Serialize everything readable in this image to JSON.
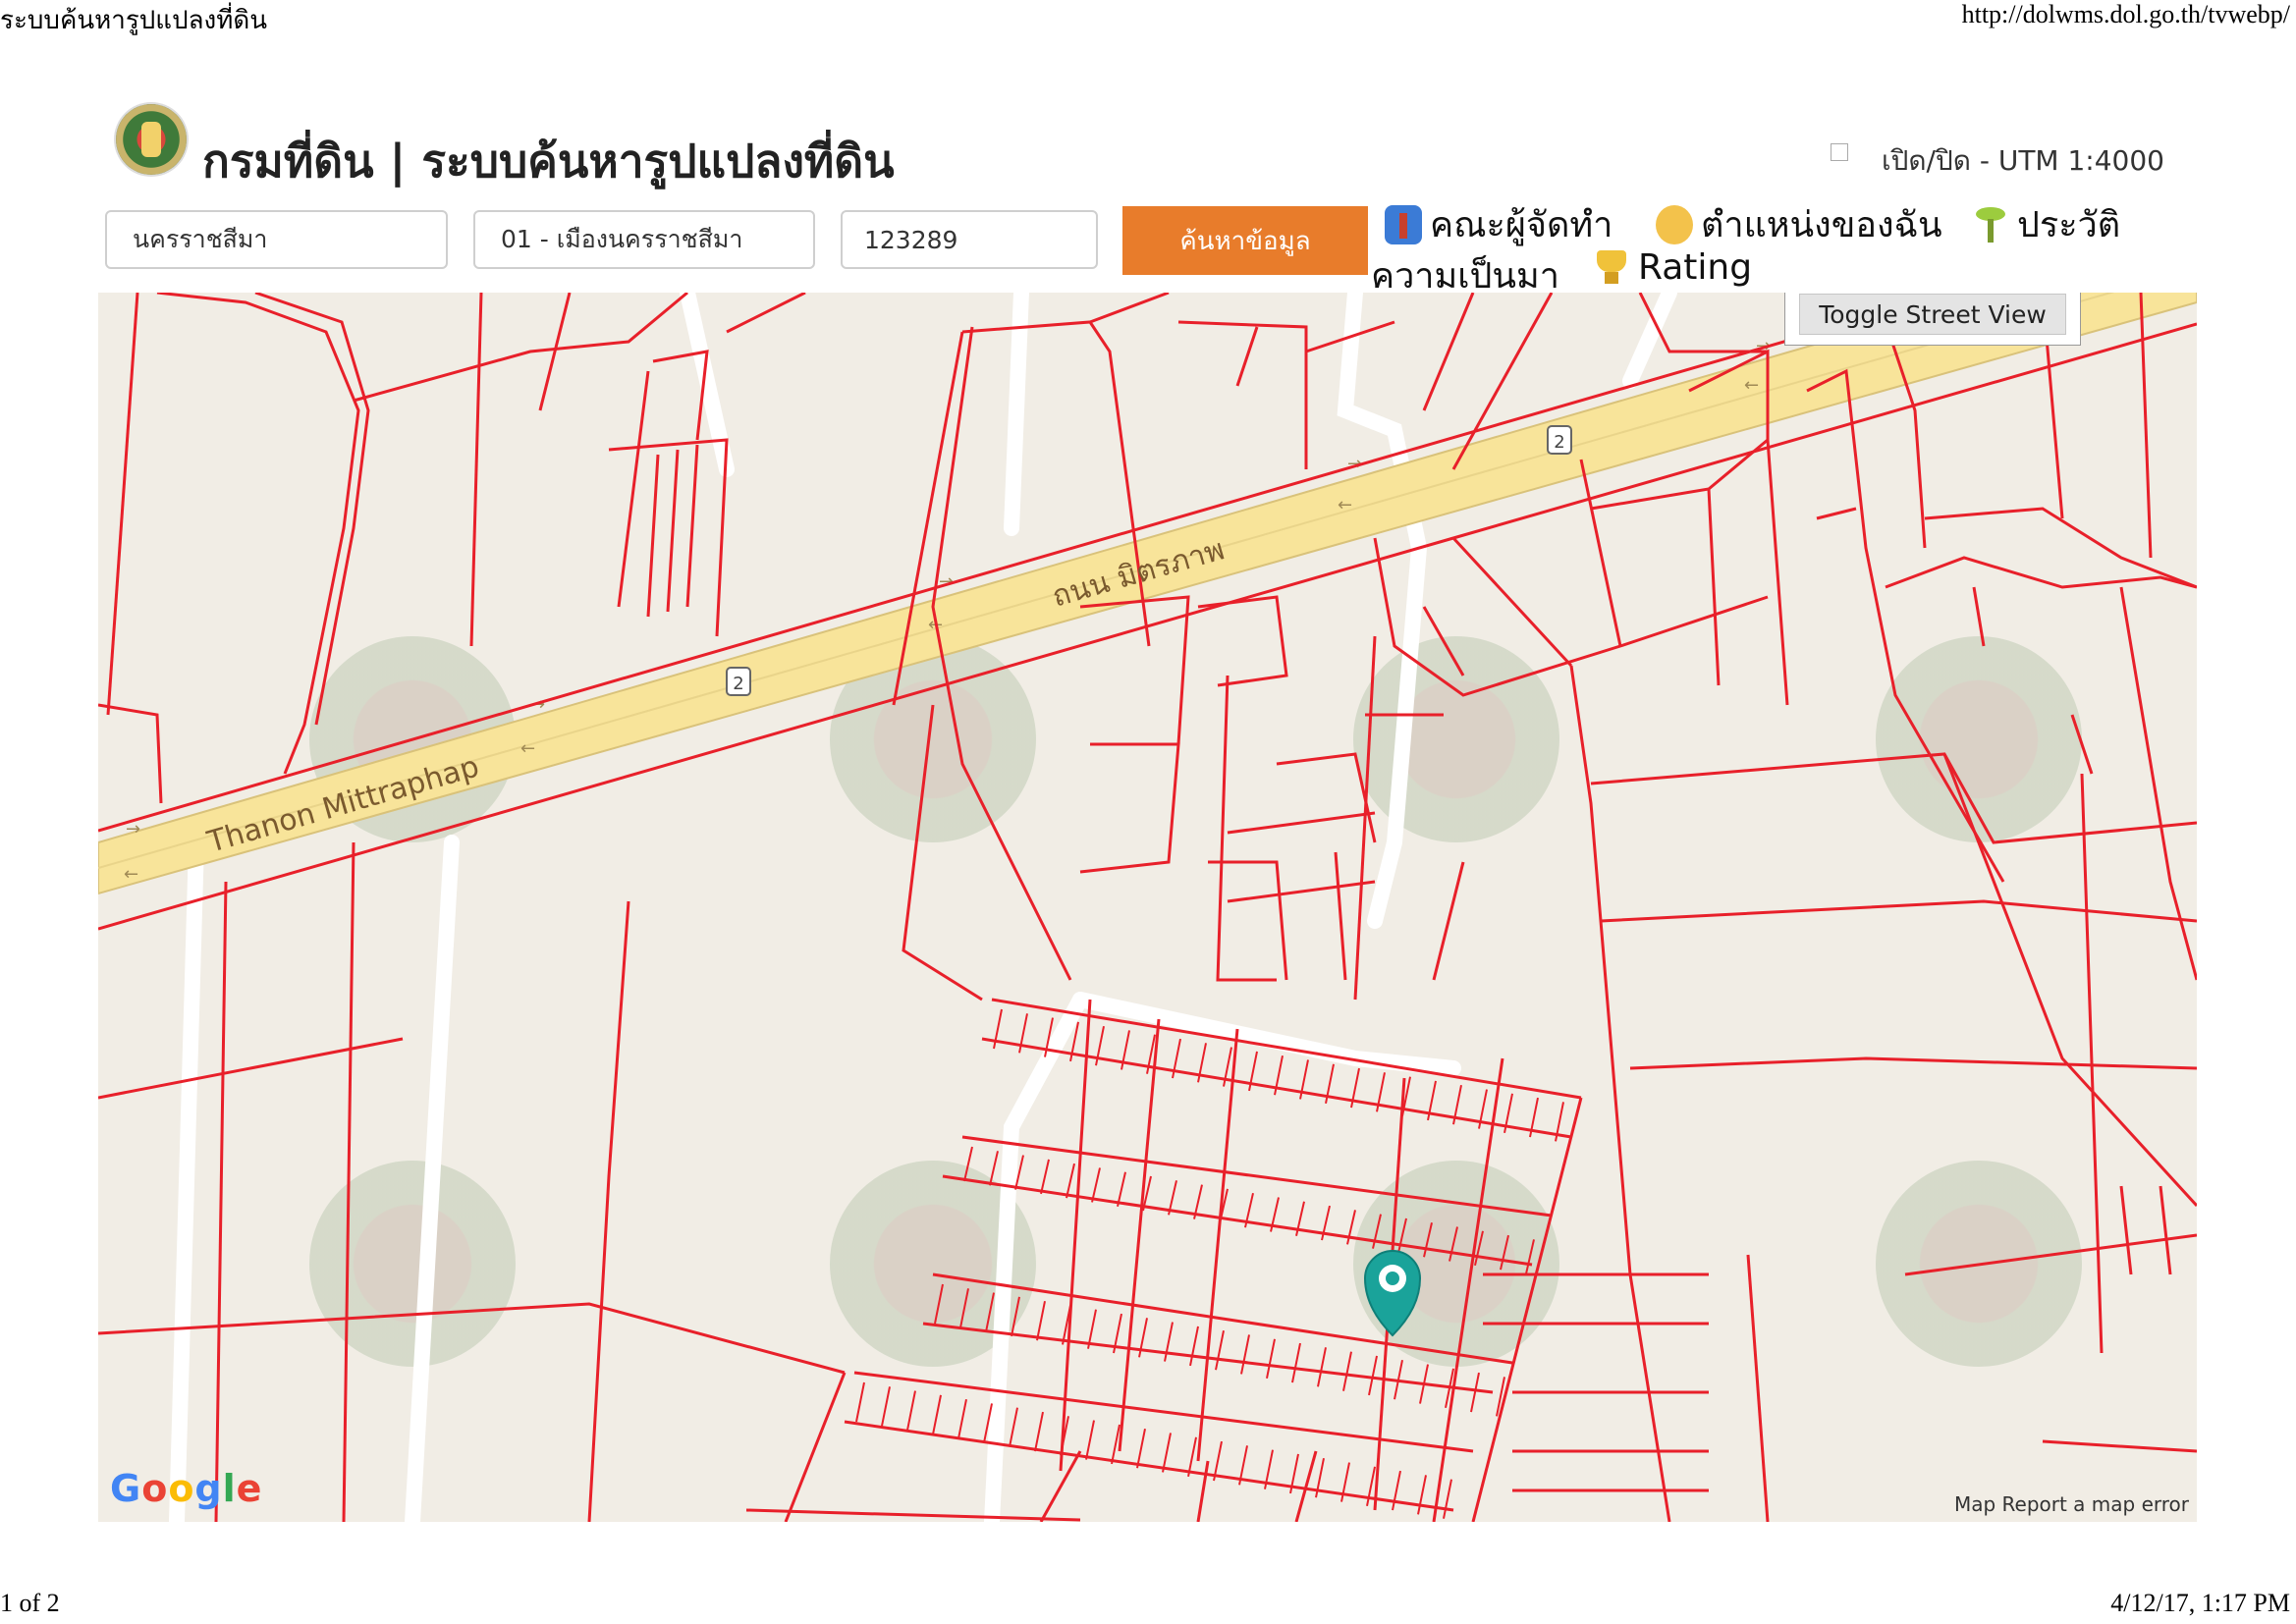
{
  "print_header": {
    "title": "ระบบค้นหารูปแปลงที่ดิน",
    "url": "http://dolwms.dol.go.th/tvwebp/"
  },
  "print_footer": {
    "page": "1 of 2",
    "datetime": "4/12/17, 1:17 PM"
  },
  "header": {
    "title": "กรมที่ดิน | ระบบค้นหารูปแปลงที่ดิน",
    "utm_toggle_label": "เปิด/ปิด - UTM 1:4000",
    "logo_icon": "department-seal-icon"
  },
  "search": {
    "province": "นครราชสีมา",
    "district": "01 - เมืองนครราชสีมา",
    "parcel_number": "123289",
    "button_label": "ค้นหาข้อมูล",
    "button_color": "#e87c2b"
  },
  "nav": {
    "team": "คณะผู้จัดทำ",
    "my_location": "ตำแหน่งของฉัน",
    "history_part1": "ประวัติ",
    "history_part2": "ความเป็นมา",
    "rating": "Rating"
  },
  "map": {
    "street_view_button": "Toggle Street View",
    "road_label_en": "Thanon Mittraphap",
    "road_label_th": "ถนน มิตรภาพ",
    "route_shield": "2",
    "google_logo": "Google",
    "footer_map_data": "Map",
    "footer_report": "Report a map error",
    "parcel_line_color": "#e8202a",
    "highway_color": "#f8e49a",
    "marker_color": "#1aa39a"
  }
}
